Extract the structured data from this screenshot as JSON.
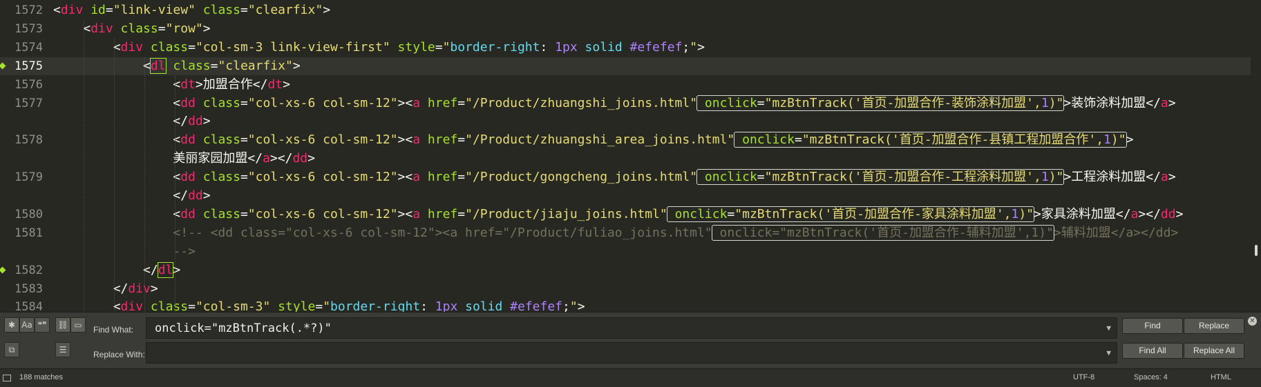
{
  "editor": {
    "lines": [
      {
        "num": "1572",
        "html": "&lt;<span class='t'>div</span> <span class='a'>id</span>=<span class='s'>\"link-view\"</span> <span class='a'>class</span>=<span class='s'>\"clearfix\"</span>&gt;"
      },
      {
        "num": "1573",
        "html": "    &lt;<span class='t'>div</span> <span class='a'>class</span>=<span class='s'>\"row\"</span>&gt;"
      },
      {
        "num": "1574",
        "html": "        &lt;<span class='t'>div</span> <span class='a'>class</span>=<span class='s'>\"col-sm-3 link-view-first\"</span> <span class='a'>style</span>=<span class='s'>\"</span><span class='v'>border-right</span>: <span class='n'>1px</span> <span class='v'>solid</span> <span class='n'>#efefef</span>;<span class='s'>\"</span>&gt;"
      },
      {
        "num": "1575",
        "html": "            &lt;<span class='t tagbox'>dl</span> <span class='a'>class</span>=<span class='s'>\"clearfix\"</span>&gt;"
      },
      {
        "num": "1576",
        "html": "                &lt;<span class='t'>dt</span>&gt;加盟合作&lt;/<span class='t'>dt</span>&gt;"
      },
      {
        "num": "1577",
        "html": "                &lt;<span class='t'>dd</span> <span class='a'>class</span>=<span class='s'>\"col-xs-6 col-sm-12\"</span>&gt;&lt;<span class='t'>a</span> <span class='a'>href</span>=<span class='s'>\"/Product/zhuangshi_joins.html\"</span><span class='hl'> <span class='a'>onclick</span>=<span class='s'>\"mzBtnTrack('首页-加盟合作-装饰涂料加盟',</span><span class='n'>1</span><span class='s'>)\"</span></span>&gt;装饰涂料加盟&lt;/<span class='t'>a</span>&gt;"
      },
      {
        "num": "",
        "html": "                &lt;/<span class='t'>dd</span>&gt;"
      },
      {
        "num": "1578",
        "html": "                &lt;<span class='t'>dd</span> <span class='a'>class</span>=<span class='s'>\"col-xs-6 col-sm-12\"</span>&gt;&lt;<span class='t'>a</span> <span class='a'>href</span>=<span class='s'>\"/Product/zhuangshi_area_joins.html\"</span><span class='hl'> <span class='a'>onclick</span>=<span class='s'>\"mzBtnTrack('首页-加盟合作-县镇工程加盟合作',</span><span class='n'>1</span><span class='s'>)\"</span></span>&gt;"
      },
      {
        "num": "",
        "html": "                美丽家园加盟&lt;/<span class='t'>a</span>&gt;&lt;/<span class='t'>dd</span>&gt;"
      },
      {
        "num": "1579",
        "html": "                &lt;<span class='t'>dd</span> <span class='a'>class</span>=<span class='s'>\"col-xs-6 col-sm-12\"</span>&gt;&lt;<span class='t'>a</span> <span class='a'>href</span>=<span class='s'>\"/Product/gongcheng_joins.html\"</span><span class='hl'> <span class='a'>onclick</span>=<span class='s'>\"mzBtnTrack('首页-加盟合作-工程涂料加盟',</span><span class='n'>1</span><span class='s'>)\"</span></span>&gt;工程涂料加盟&lt;/<span class='t'>a</span>&gt;"
      },
      {
        "num": "",
        "html": "                &lt;/<span class='t'>dd</span>&gt;"
      },
      {
        "num": "1580",
        "html": "                &lt;<span class='t'>dd</span> <span class='a'>class</span>=<span class='s'>\"col-xs-6 col-sm-12\"</span>&gt;&lt;<span class='t'>a</span> <span class='a'>href</span>=<span class='s'>\"/Product/jiaju_joins.html\"</span><span class='hl'> <span class='a'>onclick</span>=<span class='s'>\"mzBtnTrack('首页-加盟合作-家具涂料加盟',</span><span class='n'>1</span><span class='s'>)\"</span></span>&gt;家具涂料加盟&lt;/<span class='t'>a</span>&gt;&lt;/<span class='t'>dd</span>&gt;"
      },
      {
        "num": "1581",
        "html": "                <span class='c'>&lt;!-- &lt;dd class=\"col-xs-6 col-sm-12\"&gt;&lt;a href=\"/Product/fuliao_joins.html\"<span class='hl'> onclick=\"mzBtnTrack('首页-加盟合作-辅料加盟',1)\"</span>&gt;辅料加盟&lt;/a&gt;&lt;/dd&gt;</span>"
      },
      {
        "num": "",
        "html": "                <span class='c'>--&gt;</span>"
      },
      {
        "num": "1582",
        "html": "            &lt;/<span class='t tagbox'>dl</span>&gt;"
      },
      {
        "num": "1583",
        "html": "        &lt;/<span class='t'>div</span>&gt;"
      },
      {
        "num": "1584",
        "html": "        &lt;<span class='t'>div</span> <span class='a'>class</span>=<span class='s'>\"col-sm-3\"</span> <span class='a'>style</span>=<span class='s'>\"</span><span class='v'>border-right</span>: <span class='n'>1px</span> <span class='v'>solid</span> <span class='n'>#efefef</span>;<span class='s'>\"</span>&gt;"
      }
    ],
    "current_line": "1575",
    "bookmarked_lines": [
      "1575",
      "1582"
    ]
  },
  "find_panel": {
    "options": [
      {
        "name": "regex-toggle",
        "glyph": "✱",
        "on": true
      },
      {
        "name": "case-sensitive-toggle",
        "glyph": "Aa",
        "on": false
      },
      {
        "name": "whole-word-toggle",
        "glyph": "❝❞",
        "on": false
      },
      {
        "name": "wrap-toggle",
        "glyph": "⛓",
        "on": true
      },
      {
        "name": "in-selection-toggle",
        "glyph": "▭",
        "on": true
      }
    ],
    "find_label": "Find What:",
    "find_value": "onclick=\"mzBtnTrack(.*?)\"",
    "replace_label": "Replace With:",
    "replace_value": "",
    "find_button": "Find",
    "replace_button": "Replace",
    "find_all_button": "Find All",
    "replace_all_button": "Replace All"
  },
  "status_bar": {
    "matches": "188 matches",
    "encoding": "UTF-8",
    "indent": "Spaces: 4",
    "syntax": "HTML"
  }
}
